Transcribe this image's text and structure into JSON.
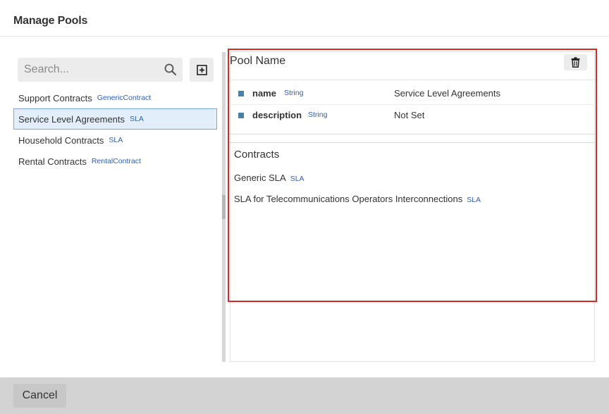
{
  "dialog": {
    "title": "Manage Pools"
  },
  "search": {
    "placeholder": "Search..."
  },
  "pools": [
    {
      "name": "Support Contracts",
      "type": "GenericContract",
      "selected": false
    },
    {
      "name": "Service Level Agreements",
      "type": "SLA",
      "selected": true
    },
    {
      "name": "Household Contracts",
      "type": "SLA",
      "selected": false
    },
    {
      "name": "Rental Contracts",
      "type": "RentalContract",
      "selected": false
    }
  ],
  "detail": {
    "pool_name_label": "Pool Name",
    "properties": [
      {
        "name": "name",
        "type": "String",
        "value": "Service Level Agreements"
      },
      {
        "name": "description",
        "type": "String",
        "value": "Not Set"
      }
    ],
    "contracts_title": "Contracts",
    "contracts": [
      {
        "name": "Generic SLA",
        "type": "SLA"
      },
      {
        "name": "SLA for Telecommunications Operators Interconnections",
        "type": "SLA"
      }
    ]
  },
  "footer": {
    "cancel_label": "Cancel"
  },
  "icons": {
    "search": "search-icon",
    "add": "plus-square-icon",
    "delete": "trash-icon"
  },
  "colors": {
    "accent_type": "#2f5fb8",
    "selection_bg": "#e3eefb",
    "highlight_border": "#d42a2a",
    "property_marker": "#4a7fa8"
  }
}
